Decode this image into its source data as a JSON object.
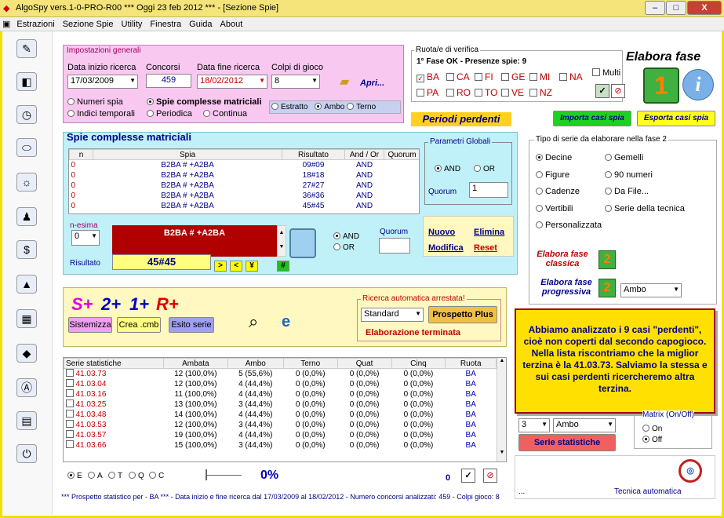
{
  "window": {
    "title": "AlgoSpy vers.1-0-PRO-R00  ***  Oggi 23 feb 2012  ***   - [Sezione Spie]",
    "min": "–",
    "max": "□",
    "close": "X"
  },
  "menu": [
    "Estrazioni",
    "Sezione Spie",
    "Utility",
    "Finestra",
    "Guida",
    "About"
  ],
  "toolbar": [
    "pencil-icon",
    "eraser-icon",
    "clock-icon",
    "pill-icon",
    "bulb-icon",
    "juggler-icon",
    "dollar-icon",
    "pyramid-icon",
    "calendar-icon",
    "diamond-icon",
    "a-icon",
    "notebook-icon",
    "power-icon"
  ],
  "settings": {
    "group": "Impostazioni generali",
    "date_start_label": "Data inizio ricerca",
    "date_start": "17/03/2009",
    "draws_label": "Concorsi",
    "draws": "459",
    "date_end_label": "Data fine ricerca",
    "date_end": "18/02/2012",
    "shots_label": "Colpi di gioco",
    "shots": "8",
    "open": "Apri...",
    "opt_numeri": "Numeri spia",
    "opt_indici": "Indici temporali",
    "opt_spie": "Spie complesse matriciali",
    "opt_periodica": "Periodica",
    "opt_continua": "Continua",
    "opt_estratto": "Estratto",
    "opt_ambo": "Ambo",
    "opt_terno": "Terno"
  },
  "wheels": {
    "group": "Ruota/e di verifica",
    "status": "1° Fase OK - Presenze spie: 9",
    "row1": [
      "BA",
      "CA",
      "FI",
      "GE",
      "MI",
      "NA"
    ],
    "row2": [
      "PA",
      "RO",
      "TO",
      "VE",
      "NZ"
    ],
    "multi": "Multi"
  },
  "phase": {
    "title": "Elabora fase",
    "one": "1",
    "info": "i"
  },
  "periodi": "Periodi perdenti",
  "import": "Importa casi spia",
  "export": "Esporta casi spia",
  "spie": {
    "title": "Spie complesse matriciali",
    "cols": [
      "n",
      "Spia",
      "Risultato",
      "And / Or",
      "Quorum"
    ],
    "rows": [
      [
        "0",
        "B2BA # +A2BA",
        "09#09",
        "AND",
        ""
      ],
      [
        "0",
        "B2BA # +A2BA",
        "18#18",
        "AND",
        ""
      ],
      [
        "0",
        "B2BA # +A2BA",
        "27#27",
        "AND",
        ""
      ],
      [
        "0",
        "B2BA # +A2BA",
        "36#36",
        "AND",
        ""
      ],
      [
        "0",
        "B2BA # +A2BA",
        "45#45",
        "AND",
        ""
      ]
    ],
    "params": "Parametri Globali",
    "and": "AND",
    "or": "OR",
    "quorum_label": "Quorum",
    "quorum": "1",
    "nesima_label": "n-esima",
    "nesima": "0",
    "formula": "B2BA # +A2BA",
    "risultato_label": "Risultato",
    "risultato": "45#45",
    "k1": ">",
    "k2": "<",
    "k3": "¥",
    "k4": "#",
    "and2": "AND",
    "or2": "OR",
    "quorum2": "Quorum",
    "nuovo": "Nuovo",
    "elimina": "Elimina",
    "modifica": "Modifica",
    "reset": "Reset"
  },
  "series": {
    "group": "Tipo di serie da elaborare nella fase 2",
    "opts": [
      "Decine",
      "Gemelli",
      "Figure",
      "90 numeri",
      "Cadenze",
      "Da File...",
      "Vertibili",
      "Serie della tecnica",
      "Personalizzata"
    ],
    "classica": "Elabora fase classica",
    "progressiva": "Elabora fase progressiva",
    "two": "2",
    "ambo": "Ambo"
  },
  "lower": {
    "s": "S+",
    "two": "2+",
    "one": "1+",
    "r": "R+",
    "sistemizza": "Sistemizza",
    "cmb": "Crea .cmb",
    "esito": "Esito serie",
    "ricerca": "Ricerca automatica arrestata!",
    "standard": "Standard",
    "plus": "Prospetto Plus",
    "done": "Elaborazione terminata"
  },
  "stats": {
    "cols": [
      "Serie statistiche",
      "Ambata",
      "Ambo",
      "Terno",
      "Quat",
      "Cinq",
      "Ruota"
    ],
    "rows": [
      [
        "41.03.73",
        "12 (100,0%)",
        "5 (55,6%)",
        "0 (0,0%)",
        "0 (0,0%)",
        "0 (0,0%)",
        "BA"
      ],
      [
        "41.03.04",
        "12 (100,0%)",
        "4 (44,4%)",
        "0 (0,0%)",
        "0 (0,0%)",
        "0 (0,0%)",
        "BA"
      ],
      [
        "41.03.16",
        "11 (100,0%)",
        "4 (44,4%)",
        "0 (0,0%)",
        "0 (0,0%)",
        "0 (0,0%)",
        "BA"
      ],
      [
        "41.03.25",
        "13 (100,0%)",
        "3 (44,4%)",
        "0 (0,0%)",
        "0 (0,0%)",
        "0 (0,0%)",
        "BA"
      ],
      [
        "41.03.48",
        "14 (100,0%)",
        "4 (44,4%)",
        "0 (0,0%)",
        "0 (0,0%)",
        "0 (0,0%)",
        "BA"
      ],
      [
        "41.03.53",
        "12 (100,0%)",
        "3 (44,4%)",
        "0 (0,0%)",
        "0 (0,0%)",
        "0 (0,0%)",
        "BA"
      ],
      [
        "41.03.57",
        "19 (100,0%)",
        "4 (44,4%)",
        "0 (0,0%)",
        "0 (0,0%)",
        "0 (0,0%)",
        "BA"
      ],
      [
        "41.03.66",
        "15 (100,0%)",
        "3 (44,4%)",
        "0 (0,0%)",
        "0 (0,0%)",
        "0 (0,0%)",
        "BA"
      ]
    ]
  },
  "note": "Abbiamo analizzato i 9 casi \"perdenti\", cioè non coperti dal secondo capogioco. Nella lista riscontriamo che la miglior terzina è la 41.03.73. Salviamo la stessa e sui casi perdenti ricercheremo altra terzina.",
  "right_low": {
    "three": "3",
    "ambo": "Ambo",
    "matrix": "Matrix (On/Off)",
    "on": "On",
    "off": "Off",
    "serie": "Serie statistiche",
    "dots": "...",
    "tecnica": "Tecnica automatica"
  },
  "bottom": {
    "radios": [
      "E",
      "A",
      "T",
      "Q",
      "C"
    ],
    "percent": "0%",
    "zero": "0",
    "status": "*** Prospetto statistico per  - BA *** - Data inizio e fine ricerca dal 17/03/2009 al 18/02/2012 - Numero concorsi analizzati: 459 - Colpi gioco: 8"
  }
}
